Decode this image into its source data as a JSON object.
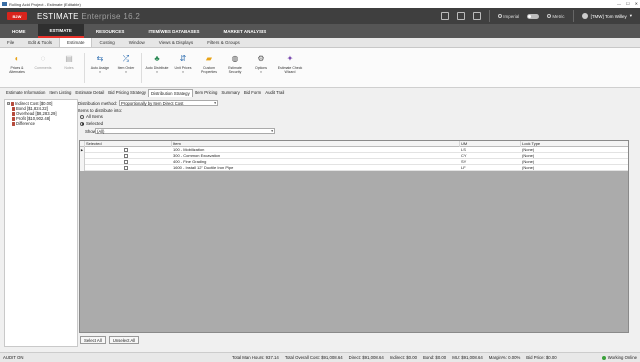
{
  "window": {
    "title": "Rolling Acid Project - Estimate (Editable)"
  },
  "brand": {
    "logo": "B2W",
    "product": "ESTIMATE",
    "edition": "Enterprise 16.2",
    "imperial": "Imperial",
    "metric": "Metric",
    "user": "[TMW] Tom Willey"
  },
  "main_nav": [
    "HOME",
    "ESTIMATE",
    "RESOURCES",
    "ITEM/WBS DATABASES",
    "MARKET ANALYSIS"
  ],
  "ribbon_tabs": [
    "File",
    "Edit & Tools",
    "Estimate",
    "Costing",
    "Window",
    "Views & Displays",
    "Filters & Groups"
  ],
  "ribbon_buttons": [
    {
      "label": "Prices & Alternates",
      "icon": "prices-icon"
    },
    {
      "label": "Comments",
      "icon": "comments-icon"
    },
    {
      "label": "Notes",
      "icon": "notes-icon"
    },
    {
      "label": "Auto Assign",
      "icon": "auto-assign-icon"
    },
    {
      "label": "Item Order",
      "icon": "item-order-icon"
    },
    {
      "label": "Auto Distribute",
      "icon": "auto-distribute-icon"
    },
    {
      "label": "Unit Prices",
      "icon": "unit-prices-icon"
    },
    {
      "label": "Custom Properties",
      "icon": "custom-properties-icon"
    },
    {
      "label": "Estimate Security",
      "icon": "security-icon"
    },
    {
      "label": "Options",
      "icon": "options-icon"
    },
    {
      "label": "Estimate Check Wizard",
      "icon": "wizard-icon"
    }
  ],
  "sub_tabs": [
    "Estimate Information",
    "Item Listing",
    "Estimate Detail",
    "Bid Pricing Strategy",
    "Distribution Strategy",
    "Item Pricing",
    "Summary",
    "Bid Form",
    "Audit Trail"
  ],
  "tree": [
    "Indirect Cost [$0.00]",
    "Bond [$1,824.22]",
    "Overhead [$8,283.29]",
    "Profit [$10,902.48]",
    "Difference"
  ],
  "panel": {
    "distribution_label": "Distribution method:",
    "distribution_value": "Proportionally by Item Direct Cost",
    "items_label": "Items to distribute into:",
    "all_items": "All Items",
    "selected": "Selected",
    "show_label": "Show:",
    "show_value": "(All)"
  },
  "grid": {
    "columns": [
      "Selected",
      "Item",
      "UM",
      "Lock Type"
    ],
    "rows": [
      {
        "item": "100 - Mobilization",
        "um": "LS",
        "lock": "(None)"
      },
      {
        "item": "300 - Common Excavation",
        "um": "CY",
        "lock": "(None)"
      },
      {
        "item": "400 - Fine Grading",
        "um": "SY",
        "lock": "(None)"
      },
      {
        "item": "1600 - Install 12\" Ductile Iron Pipe",
        "um": "LF",
        "lock": "(None)"
      }
    ]
  },
  "buttons": {
    "select_all": "Select All",
    "unselect_all": "Unselect All"
  },
  "status": {
    "audit": "AUDIT ON",
    "stats": [
      "Total Man Hours: 937.14",
      "Total Overall Cost: $91,008.64",
      "Direct: $91,008.64",
      "Indirect: $0.00",
      "Bond: $0.00",
      "MU: $91,008.64",
      "Margin%: 0.00%",
      "Bid Price: $0.00"
    ],
    "online": "Working Online"
  }
}
